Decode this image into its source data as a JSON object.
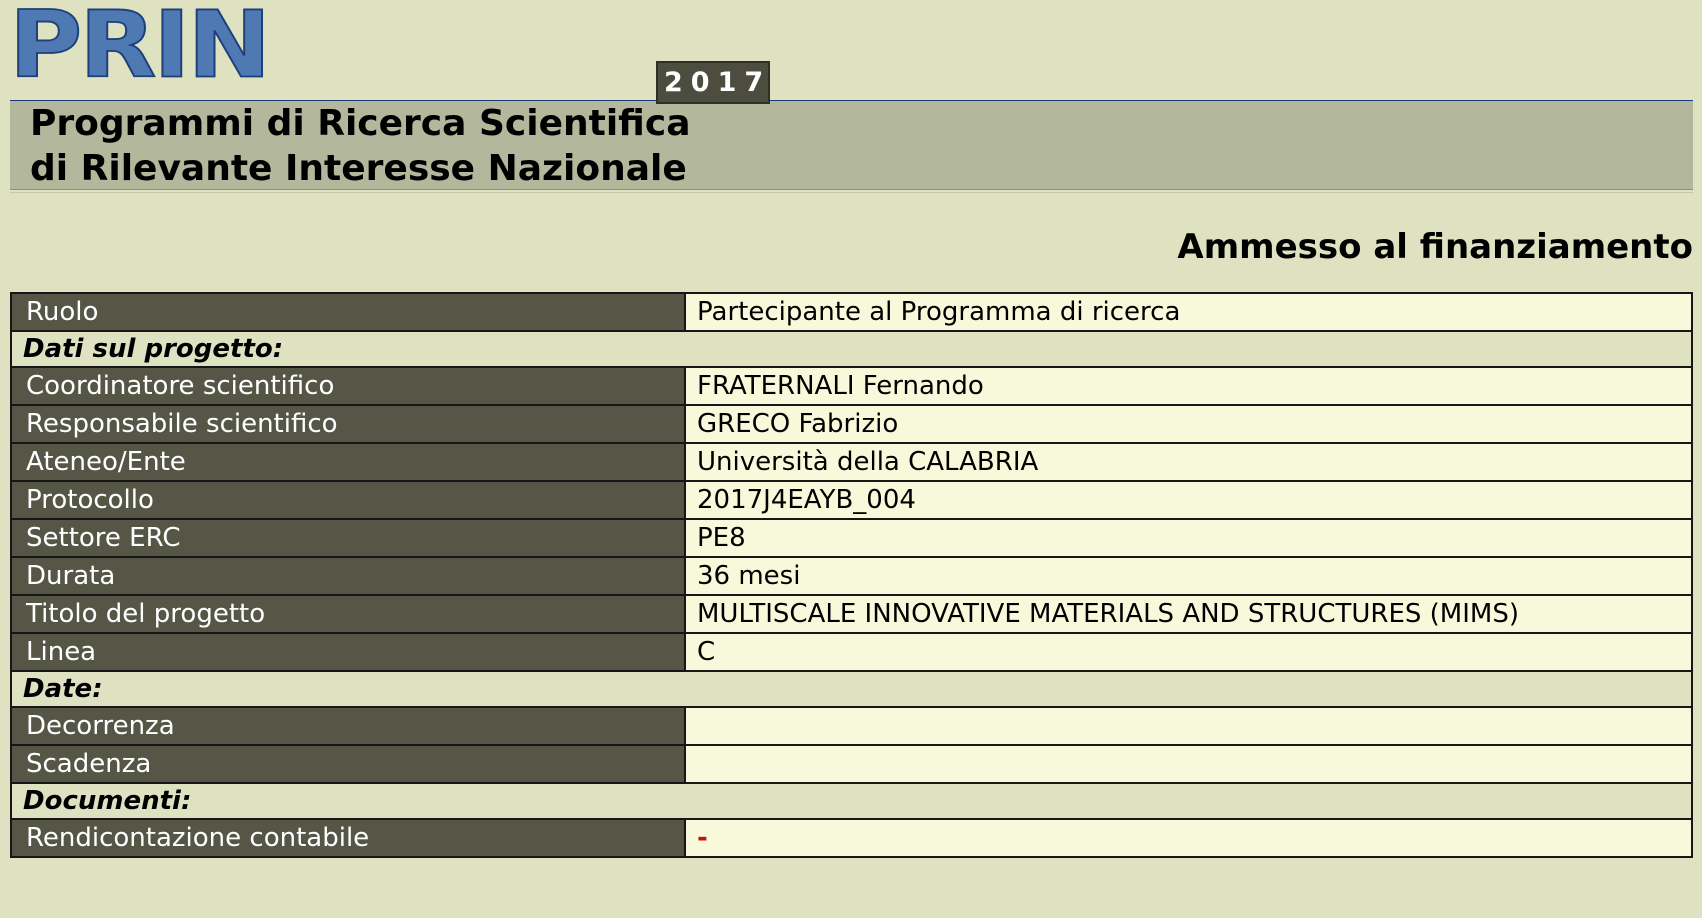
{
  "header": {
    "logo_text": "PRIN",
    "year": "2017",
    "title_line1": "Programmi di Ricerca Scientifica",
    "title_line2": "di Rilevante Interesse Nazionale"
  },
  "status": "Ammesso al finanziamento",
  "rows": {
    "ruolo": {
      "label": "Ruolo",
      "value": "Partecipante al Programma di ricerca"
    },
    "section_progetto": "Dati sul progetto:",
    "coordinatore": {
      "label": "Coordinatore scientifico",
      "value": "FRATERNALI Fernando"
    },
    "responsabile": {
      "label": "Responsabile scientifico",
      "value": "GRECO Fabrizio"
    },
    "ateneo": {
      "label": "Ateneo/Ente",
      "value": "Università della CALABRIA"
    },
    "protocollo": {
      "label": "Protocollo",
      "value": "2017J4EAYB_004"
    },
    "settore": {
      "label": "Settore ERC",
      "value": "PE8"
    },
    "durata": {
      "label": "Durata",
      "value": "36 mesi"
    },
    "titolo": {
      "label": "Titolo del progetto",
      "value": "MULTISCALE INNOVATIVE MATERIALS AND STRUCTURES (MIMS)"
    },
    "linea": {
      "label": "Linea",
      "value": "C"
    },
    "section_date": "Date:",
    "decorrenza": {
      "label": "Decorrenza",
      "value": ""
    },
    "scadenza": {
      "label": "Scadenza",
      "value": ""
    },
    "section_documenti": "Documenti:",
    "rendicontazione": {
      "label": "Rendicontazione contabile",
      "value": "-"
    }
  },
  "colors": {
    "page_background": "#dfe2c1",
    "header_band": "#b3b79c",
    "label_cell": "#565647",
    "value_cell": "#f8f9da",
    "logo": "#4f79b3",
    "dash": "#c11515"
  }
}
